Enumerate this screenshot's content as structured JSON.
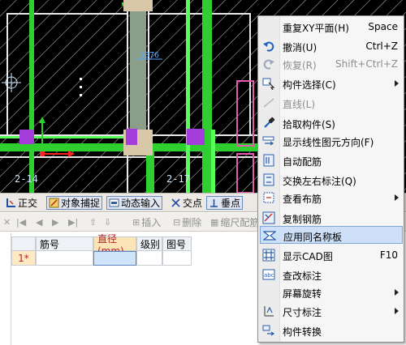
{
  "canvas": {
    "axis_labels": [
      "2-14",
      "2-17"
    ],
    "dimension_text": "5376"
  },
  "snap_toolbar": {
    "items": [
      {
        "label": "正交",
        "icon": "ortho-icon"
      },
      {
        "label": "对象捕捉",
        "icon": "object-snap-icon"
      },
      {
        "label": "动态输入",
        "icon": "dynamic-input-icon"
      },
      {
        "label": "交点",
        "icon": "intersection-icon"
      },
      {
        "label": "垂点",
        "icon": "perpendicular-icon"
      }
    ]
  },
  "rebar_toolbar": {
    "items": [
      {
        "label": "插入",
        "icon": "insert-row-icon"
      },
      {
        "label": "删除",
        "icon": "delete-row-icon"
      },
      {
        "label": "缩尺配筋",
        "icon": "scale-rebar-icon"
      }
    ]
  },
  "grid": {
    "columns": [
      "筋号",
      "直径(mm)",
      "级别",
      "图号"
    ],
    "rows": [
      {
        "row_label": "1*",
        "cells": [
          "",
          "",
          "",
          ""
        ]
      }
    ]
  },
  "context_menu": {
    "items": [
      {
        "label": "重复XY平面(H)",
        "shortcut": "Space",
        "icon": "",
        "disabled": false,
        "submenu": false
      },
      {
        "label": "撤消(U)",
        "shortcut": "Ctrl+Z",
        "icon": "undo-icon",
        "disabled": false,
        "submenu": false
      },
      {
        "label": "恢复(R)",
        "shortcut": "Shift+Ctrl+Z",
        "icon": "redo-icon",
        "disabled": true,
        "submenu": false
      },
      {
        "label": "构件选择(C)",
        "shortcut": "",
        "icon": "component-select-icon",
        "disabled": false,
        "submenu": true
      },
      {
        "label": "直线(L)",
        "shortcut": "",
        "icon": "line-icon",
        "disabled": true,
        "submenu": false
      },
      {
        "label": "拾取构件(S)",
        "shortcut": "",
        "icon": "eyedropper-icon",
        "disabled": false,
        "submenu": false
      },
      {
        "label": "显示线性图元方向(F)",
        "shortcut": "",
        "icon": "direction-icon",
        "disabled": false,
        "submenu": false
      },
      {
        "label": "自动配筋",
        "shortcut": "",
        "icon": "auto-rebar-icon",
        "disabled": false,
        "submenu": false
      },
      {
        "label": "交换左右标注(Q)",
        "shortcut": "",
        "icon": "swap-annotation-icon",
        "disabled": false,
        "submenu": false
      },
      {
        "label": "查看布筋",
        "shortcut": "",
        "icon": "view-rebar-icon",
        "disabled": false,
        "submenu": true
      },
      {
        "label": "复制钢筋",
        "shortcut": "",
        "icon": "copy-rebar-icon",
        "disabled": false,
        "submenu": false
      },
      {
        "label": "应用同名称板",
        "shortcut": "",
        "icon": "apply-same-name-icon",
        "disabled": false,
        "submenu": false,
        "highlighted": true
      },
      {
        "label": "显示CAD图",
        "shortcut": "F10",
        "icon": "show-cad-icon",
        "disabled": false,
        "submenu": false
      },
      {
        "label": "查改标注",
        "shortcut": "",
        "icon": "edit-annotation-icon",
        "disabled": false,
        "submenu": false
      },
      {
        "label": "屏幕旋转",
        "shortcut": "",
        "icon": "screen-rotate-icon",
        "disabled": false,
        "submenu": true
      },
      {
        "label": "尺寸标注",
        "shortcut": "",
        "icon": "dimension-icon",
        "disabled": false,
        "submenu": true
      },
      {
        "label": "构件转换",
        "shortcut": "",
        "icon": "component-convert-icon",
        "disabled": false,
        "submenu": false
      }
    ]
  }
}
